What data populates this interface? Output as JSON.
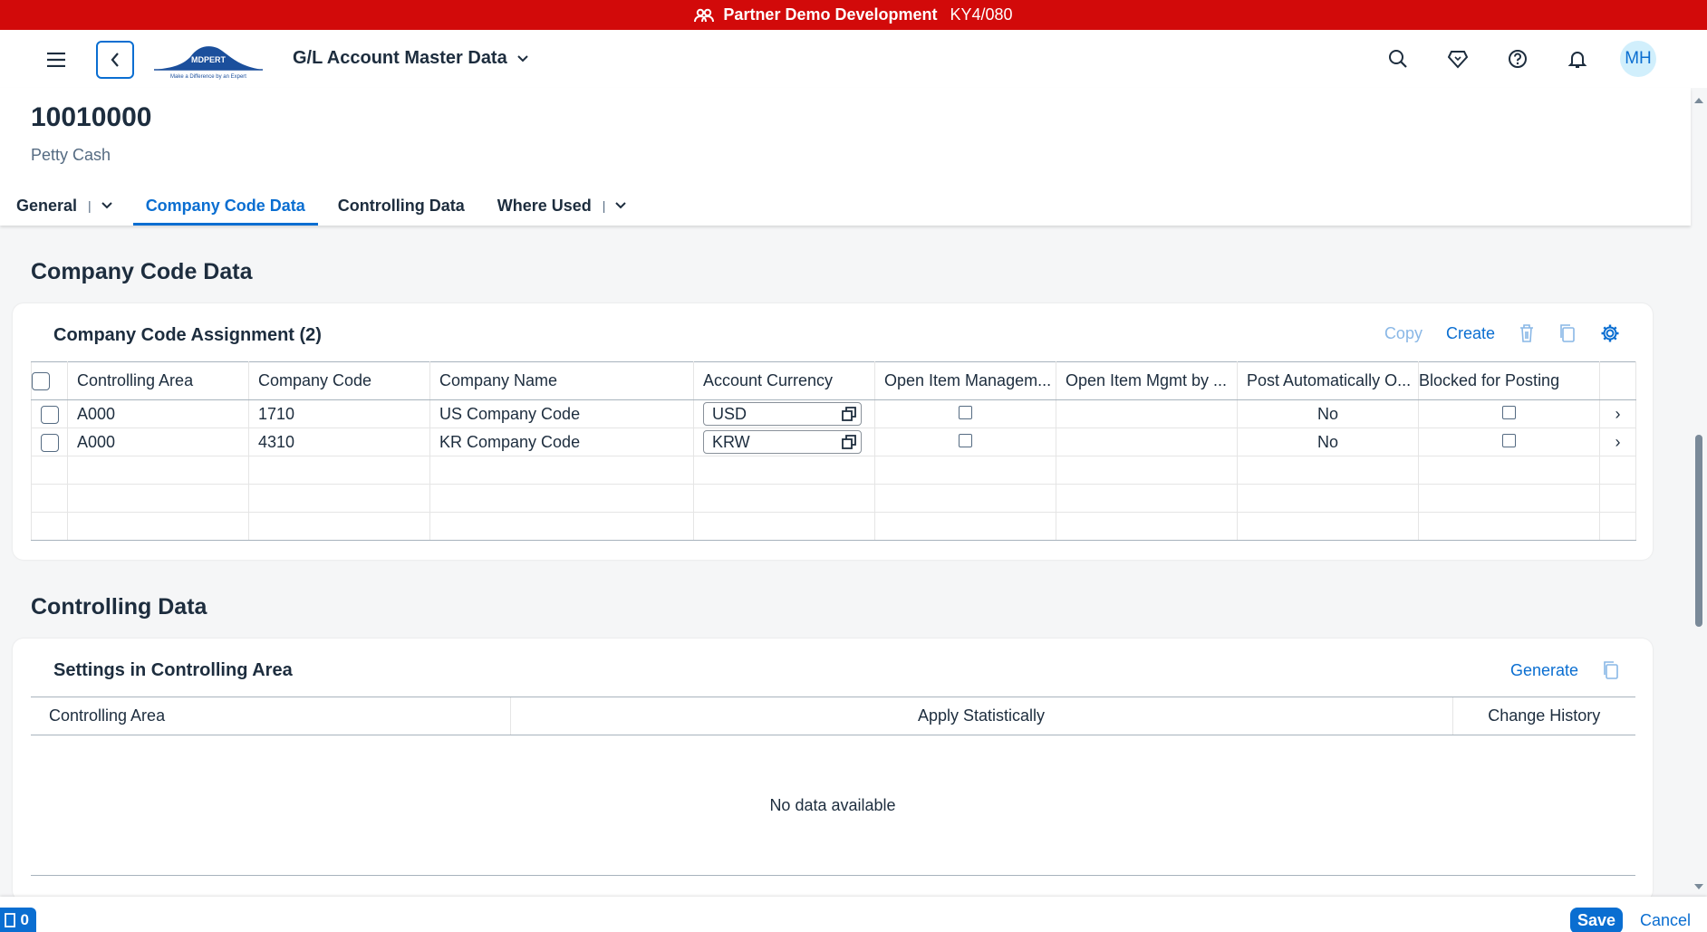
{
  "banner": {
    "title": "Partner Demo Development",
    "system": "KY4/080"
  },
  "shell": {
    "app_title": "G/L Account Master Data",
    "logo_text": "MDPERT",
    "logo_tagline": "Make a Difference by an Expert",
    "avatar": "MH"
  },
  "object": {
    "number": "10010000",
    "description": "Petty Cash"
  },
  "tabs": [
    {
      "label": "General"
    },
    {
      "label": "Company Code Data"
    },
    {
      "label": "Controlling Data"
    },
    {
      "label": "Where Used"
    }
  ],
  "company_code_section": {
    "title": "Company Code Data",
    "card_title": "Company Code Assignment (2)",
    "toolbar": {
      "copy": "Copy",
      "create": "Create"
    },
    "columns": [
      "Controlling Area",
      "Company Code",
      "Company Name",
      "Account Currency",
      "Open Item Managem...",
      "Open Item Mgmt by ...",
      "Post Automatically O...",
      "Blocked for Posting"
    ],
    "rows": [
      {
        "controlling_area": "A000",
        "company_code": "1710",
        "company_name": "US Company Code",
        "currency": "USD",
        "post_auto": "No"
      },
      {
        "controlling_area": "A000",
        "company_code": "4310",
        "company_name": "KR Company Code",
        "currency": "KRW",
        "post_auto": "No"
      }
    ]
  },
  "controlling_section": {
    "title": "Controlling Data",
    "card_title": "Settings in Controlling Area",
    "toolbar": {
      "generate": "Generate"
    },
    "columns": [
      "Controlling Area",
      "Apply Statistically",
      "Change History"
    ],
    "no_data": "No data available"
  },
  "footer": {
    "messages_count": "0",
    "save": "Save",
    "cancel": "Cancel"
  },
  "colors": {
    "banner": "#d20a0a",
    "accent": "#0a6ed1",
    "text": "#1d2d3e"
  }
}
